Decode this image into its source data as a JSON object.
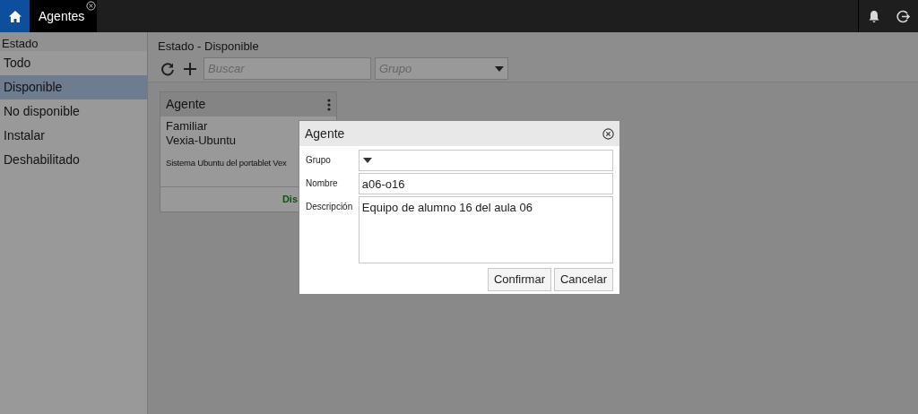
{
  "topbar": {
    "tabs": [
      {
        "label": "Agentes",
        "selected": true
      }
    ]
  },
  "sidebar": {
    "title": "Estado",
    "items": [
      {
        "label": "Todo",
        "selected": false
      },
      {
        "label": "Disponible",
        "selected": true
      },
      {
        "label": "No disponible",
        "selected": false
      },
      {
        "label": "Instalar",
        "selected": false
      },
      {
        "label": "Deshabilitado",
        "selected": false
      }
    ]
  },
  "main": {
    "title": "Estado - Disponible",
    "search": {
      "placeholder": "Buscar"
    },
    "group": {
      "placeholder": "Grupo"
    },
    "cards": [
      {
        "title": "Agente",
        "group": "Familiar",
        "name": "Vexia-Ubuntu",
        "description": "Sistema Ubuntu del portablet Vex",
        "status": "Dis"
      }
    ]
  },
  "dialog": {
    "title": "Agente",
    "fields": [
      {
        "kind": "select",
        "label": "Grupo"
      },
      {
        "kind": "text",
        "label": "Nombre",
        "value": "a06-o16"
      },
      {
        "kind": "textarea",
        "label": "Descripción",
        "value": "Equipo de alumno 16 del aula 06"
      }
    ],
    "buttons": [
      "Confirmar",
      "Cancelar"
    ]
  }
}
